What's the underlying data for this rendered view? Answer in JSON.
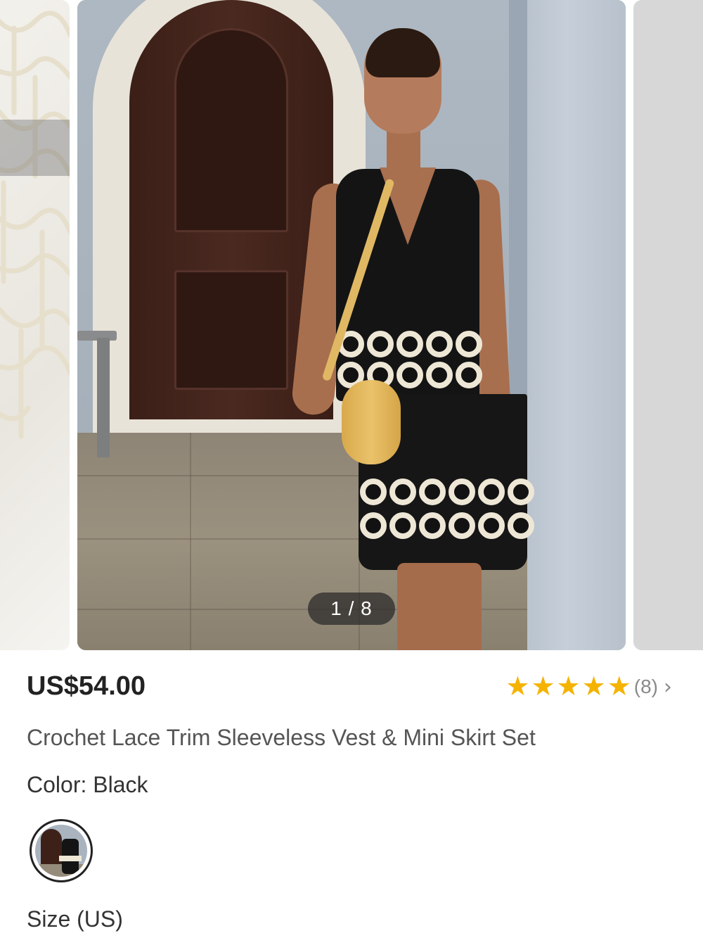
{
  "gallery": {
    "counter": "1 / 8",
    "current": 1,
    "total": 8
  },
  "product": {
    "price": "US$54.00",
    "rating": {
      "stars": 5,
      "count_label": "(8)",
      "chevron": "›"
    },
    "title": "Crochet Lace Trim Sleeveless Vest & Mini Skirt Set",
    "color_label": "Color: Black",
    "selected_color": "Black",
    "size_label": "Size (US)"
  },
  "colors": {
    "star": "#f5b301",
    "price_text": "#222222",
    "muted_text": "#8a8a8a"
  },
  "icons": {
    "star": "star-icon",
    "chevron": "chevron-right-icon"
  }
}
